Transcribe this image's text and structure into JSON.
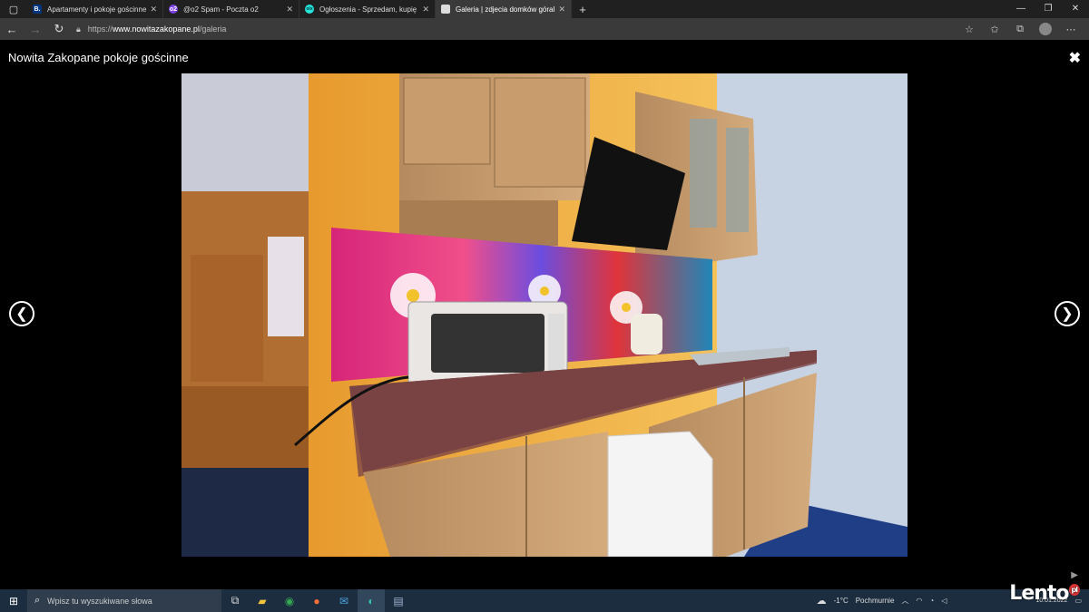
{
  "browser": {
    "tabs": [
      {
        "title": "Apartamenty i pokoje gościnne N",
        "favicon": "B.",
        "color": "#003580",
        "active": false
      },
      {
        "title": "@o2 Spam - Poczta o2",
        "favicon": "o2",
        "color": "#7b3fe4",
        "active": false
      },
      {
        "title": "Ogłoszenia - Sprzedam, kupię na",
        "favicon": "olx",
        "color": "#23e5db",
        "active": false
      },
      {
        "title": "Galeria | zdjecia domków góralski",
        "favicon": "",
        "color": "#ddd",
        "active": true
      }
    ],
    "url_prefix": "https://",
    "url_host": "www.nowitazakopane.pl",
    "url_path": "/galeria"
  },
  "gallery": {
    "title": "Nowita Zakopane pokoje gościnne",
    "close_symbol": "✖",
    "prev_symbol": "❮",
    "next_symbol": "❯"
  },
  "taskbar": {
    "search_placeholder": "Wpisz tu wyszukiwane słowa",
    "weather_temp": "-1°C",
    "weather_desc": "Pochmurnie",
    "date": "10.01.2022",
    "watermark": "Lento",
    "watermark_suffix": "pl"
  },
  "colors": {
    "accent": "#0078d4",
    "taskbar": "#1c2d3f"
  }
}
